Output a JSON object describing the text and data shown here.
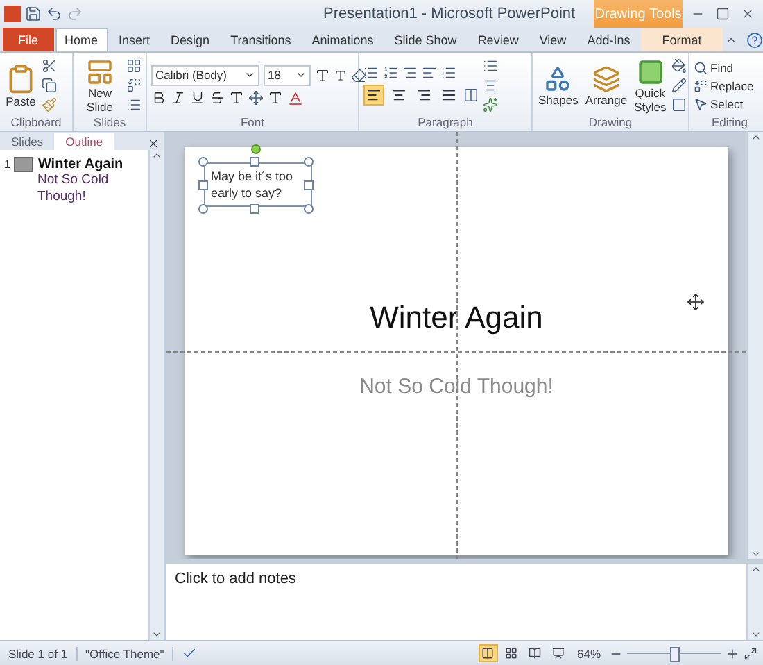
{
  "window": {
    "title": "Presentation1 - Microsoft PowerPoint",
    "contextual_tab": "Drawing Tools"
  },
  "tabs": [
    {
      "label": "File",
      "kind": "file",
      "selected": false
    },
    {
      "label": "Home",
      "kind": "tab",
      "selected": true
    },
    {
      "label": "Insert",
      "kind": "tab",
      "selected": false
    },
    {
      "label": "Design",
      "kind": "tab",
      "selected": false
    },
    {
      "label": "Transitions",
      "kind": "tab",
      "selected": false
    },
    {
      "label": "Animations",
      "kind": "tab",
      "selected": false
    },
    {
      "label": "Slide Show",
      "kind": "tab",
      "selected": false
    },
    {
      "label": "Review",
      "kind": "tab",
      "selected": false
    },
    {
      "label": "View",
      "kind": "tab",
      "selected": false
    },
    {
      "label": "Add-Ins",
      "kind": "tab",
      "selected": false
    },
    {
      "label": "Format",
      "kind": "contextual",
      "selected": false
    }
  ],
  "ribbon": {
    "groups": [
      {
        "name": "Clipboard",
        "kind": "clipboard",
        "buttons": [
          "Paste"
        ]
      },
      {
        "name": "Slides",
        "kind": "slides",
        "buttons": [
          "New Slide"
        ]
      },
      {
        "name": "Font",
        "kind": "font",
        "font_name": "Calibri (Body)",
        "font_size": "18"
      },
      {
        "name": "Paragraph",
        "kind": "paragraph",
        "alignments": [
          {
            "selected": true
          },
          {
            "selected": false
          },
          {
            "selected": false
          },
          {
            "selected": false
          }
        ]
      },
      {
        "name": "Drawing",
        "kind": "drawing",
        "buttons": [
          "Shapes",
          "Arrange",
          "Quick Styles"
        ]
      },
      {
        "name": "Editing",
        "kind": "editing",
        "buttons": [
          "Find",
          "Replace",
          "Select"
        ]
      }
    ]
  },
  "pane": {
    "tabs": [
      {
        "label": "Slides",
        "selected": false
      },
      {
        "label": "Outline",
        "selected": true
      }
    ],
    "outline": [
      {
        "number": "1",
        "title": "Winter Again",
        "body": "Not So Cold Though!"
      }
    ]
  },
  "slide": {
    "textbox": "May be it´s too early to say?",
    "textbox_selected": true,
    "title": "Winter Again",
    "subtitle": "Not So Cold Though!"
  },
  "notes": {
    "placeholder": "Click to add notes"
  },
  "status_bar": {
    "slide": "Slide 1 of 1",
    "theme": "\"Office Theme\"",
    "views": [
      {
        "selected": true
      },
      {
        "selected": false
      },
      {
        "selected": false
      },
      {
        "selected": false
      }
    ],
    "zoom": "64%",
    "zoom_slider": {
      "level": 0.5
    }
  }
}
